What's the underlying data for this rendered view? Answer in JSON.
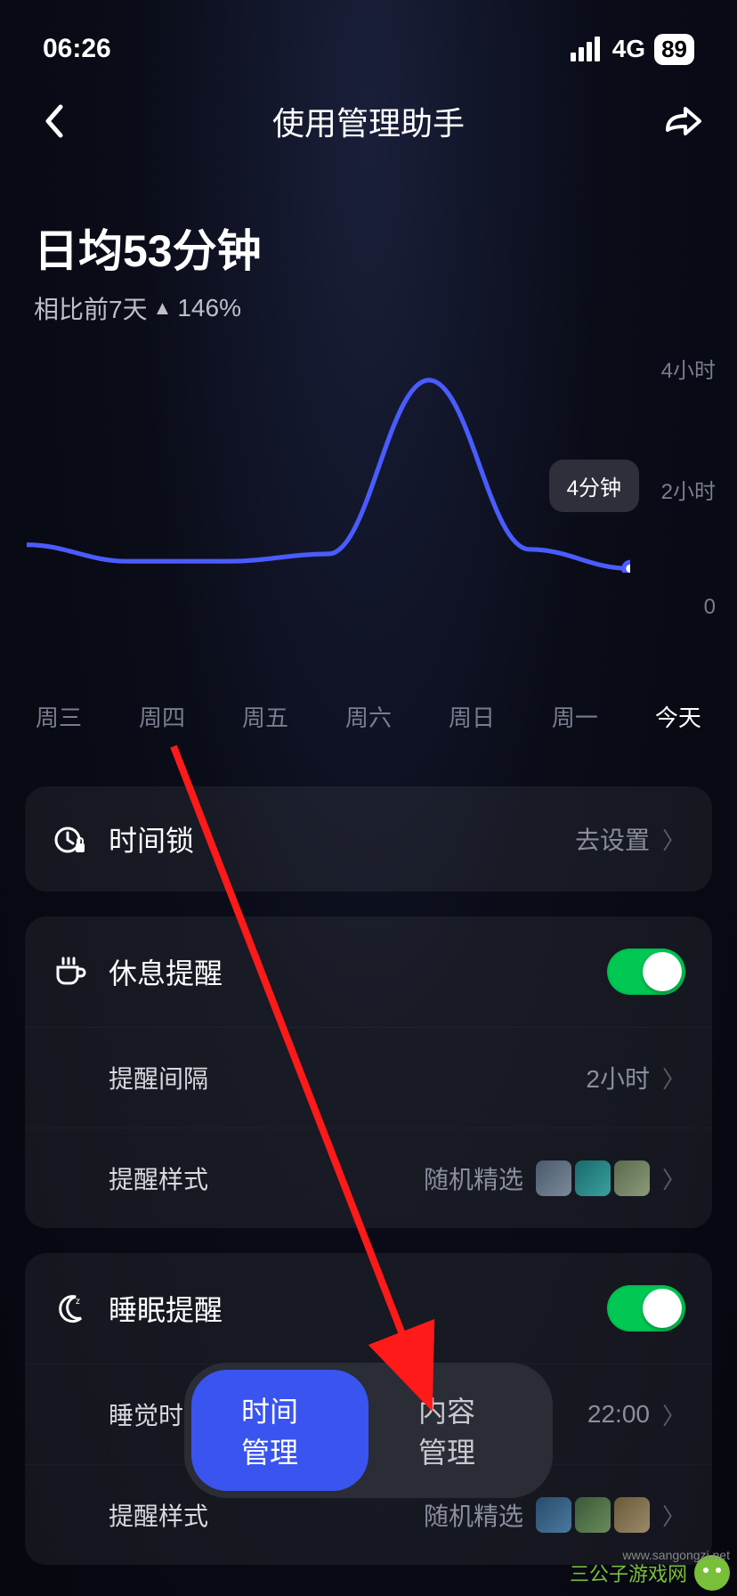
{
  "status": {
    "time": "06:26",
    "network": "4G",
    "battery": "89"
  },
  "header": {
    "title": "使用管理助手"
  },
  "summary": {
    "avg_label": "日均53分钟",
    "trend_prefix": "相比前7天",
    "trend_value": "146%"
  },
  "chart_data": {
    "type": "line",
    "categories": [
      "周三",
      "周四",
      "周五",
      "周六",
      "周日",
      "周一",
      "今天"
    ],
    "values": [
      30,
      12,
      12,
      20,
      210,
      25,
      4
    ],
    "ylabel": "",
    "ylim": [
      0,
      240
    ],
    "y_ticks": [
      "4小时",
      "2小时",
      "0"
    ],
    "active_index": 6,
    "tooltip": "4分钟"
  },
  "cards": [
    {
      "icon": "timer-lock",
      "title": "时间锁",
      "action": "去设置",
      "chev": true,
      "rows": []
    },
    {
      "icon": "coffee",
      "title": "休息提醒",
      "toggle": true,
      "rows": [
        {
          "label": "提醒间隔",
          "value": "2小时",
          "chev": true
        },
        {
          "label": "提醒样式",
          "value": "随机精选",
          "thumbs": "A",
          "chev": true
        }
      ]
    },
    {
      "icon": "moon",
      "title": "睡眠提醒",
      "toggle": true,
      "rows": [
        {
          "label": "睡觉时间",
          "value": "22:00",
          "chev": true
        },
        {
          "label": "提醒样式",
          "value": "随机精选",
          "thumbs": "B",
          "chev": true
        }
      ]
    }
  ],
  "tabs": {
    "left": "时间管理",
    "right": "内容管理",
    "active": "left"
  },
  "watermark": {
    "text": "三公子游戏网",
    "url": "www.sangongzi.net"
  }
}
